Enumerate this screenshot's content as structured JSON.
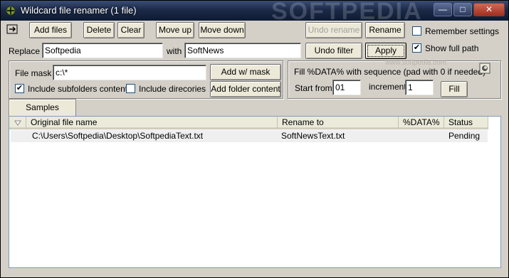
{
  "window": {
    "title": "Wildcard file renamer (1 file)",
    "watermark": "SOFTPEDIA",
    "minimize": "—",
    "maximize": "□",
    "close": "✕"
  },
  "toolbar": {
    "add_files": "Add files",
    "delete": "Delete",
    "clear": "Clear",
    "move_up": "Move up",
    "move_down": "Move down",
    "undo_rename": "Undo rename",
    "rename": "Rename",
    "remember_settings": "Remember settings",
    "remember_checked": false
  },
  "replace_row": {
    "replace_label": "Replace",
    "replace_value": "Softpedia",
    "with_label": "with",
    "with_value": "SoftNews",
    "undo_filter": "Undo filter",
    "apply": "Apply",
    "show_full_path": "Show full path",
    "show_full_path_checked": true
  },
  "mask_panel": {
    "file_mask_label": "File mask",
    "file_mask_value": "c:\\*",
    "add_w_mask": "Add w/ mask",
    "include_subfolders": "Include subfolders content",
    "include_subfolders_checked": true,
    "include_directories": "Include direcories",
    "include_directories_checked": false,
    "add_folder_content": "Add folder content"
  },
  "sequence_panel": {
    "heading": "Fill %DATA% with sequence (pad with 0 if needed)",
    "start_from_label": "Start from",
    "start_from_value": "01",
    "increment_label": "increment",
    "increment_value": "1",
    "fill": "Fill",
    "watermark_small": "www.softpedia.com"
  },
  "samples_button": "Samples",
  "file_list": {
    "columns": [
      "Original file name",
      "Rename to",
      "%DATA%",
      "Status"
    ],
    "rows": [
      {
        "original": "C:\\Users\\Softpedia\\Desktop\\SoftpediaText.txt",
        "rename_to": "SoftNewsText.txt",
        "data": "",
        "status": "Pending"
      }
    ]
  },
  "colors": {
    "window_bg": "#d4d0c8",
    "titlebar": "#1c2a48",
    "list_border": "#7f9db9"
  }
}
